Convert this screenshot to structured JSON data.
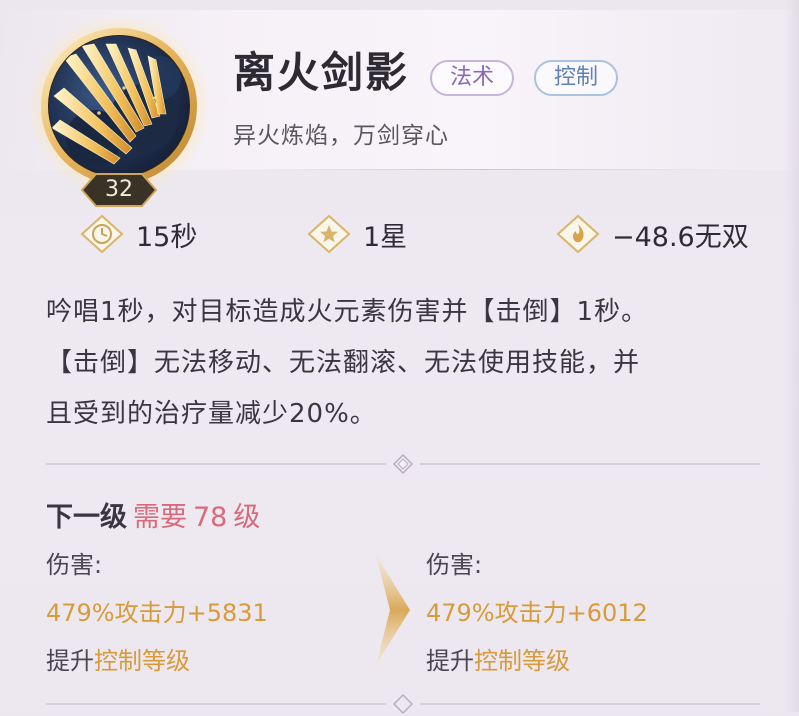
{
  "skill": {
    "name": "离火剑影",
    "tags": [
      "法术",
      "控制"
    ],
    "subtitle": "异火炼焰，万剑穿心",
    "level": "32",
    "icon": "flying-swords-icon"
  },
  "stats": {
    "cooldown": {
      "icon": "clock-icon",
      "value": "15秒"
    },
    "star": {
      "icon": "star-icon",
      "value": "1星"
    },
    "wushuang": {
      "icon": "flame-icon",
      "value": "−48.6无双"
    }
  },
  "description": [
    "吟唱1秒，对目标造成火元素伤害并【击倒】1秒。",
    "【击倒】无法移动、无法翻滚、无法使用技能，并",
    "且受到的治疗量减少20%。"
  ],
  "next_level": {
    "label": "下一级",
    "need": "需要",
    "level": "78",
    "unit": "级",
    "current": {
      "damage_label": "伤害:",
      "damage_value": "479%攻击力+5831",
      "upgrade_prefix": "提升",
      "upgrade_link": "控制等级"
    },
    "next": {
      "damage_label": "伤害:",
      "damage_value": "479%攻击力+6012",
      "upgrade_prefix": "提升",
      "upgrade_link": "控制等级"
    }
  },
  "colors": {
    "accent_gold": "#d79b3a",
    "requirement_red": "#d96a7a",
    "tag_magic": "#8a6bb4",
    "tag_control": "#5e82b4"
  }
}
